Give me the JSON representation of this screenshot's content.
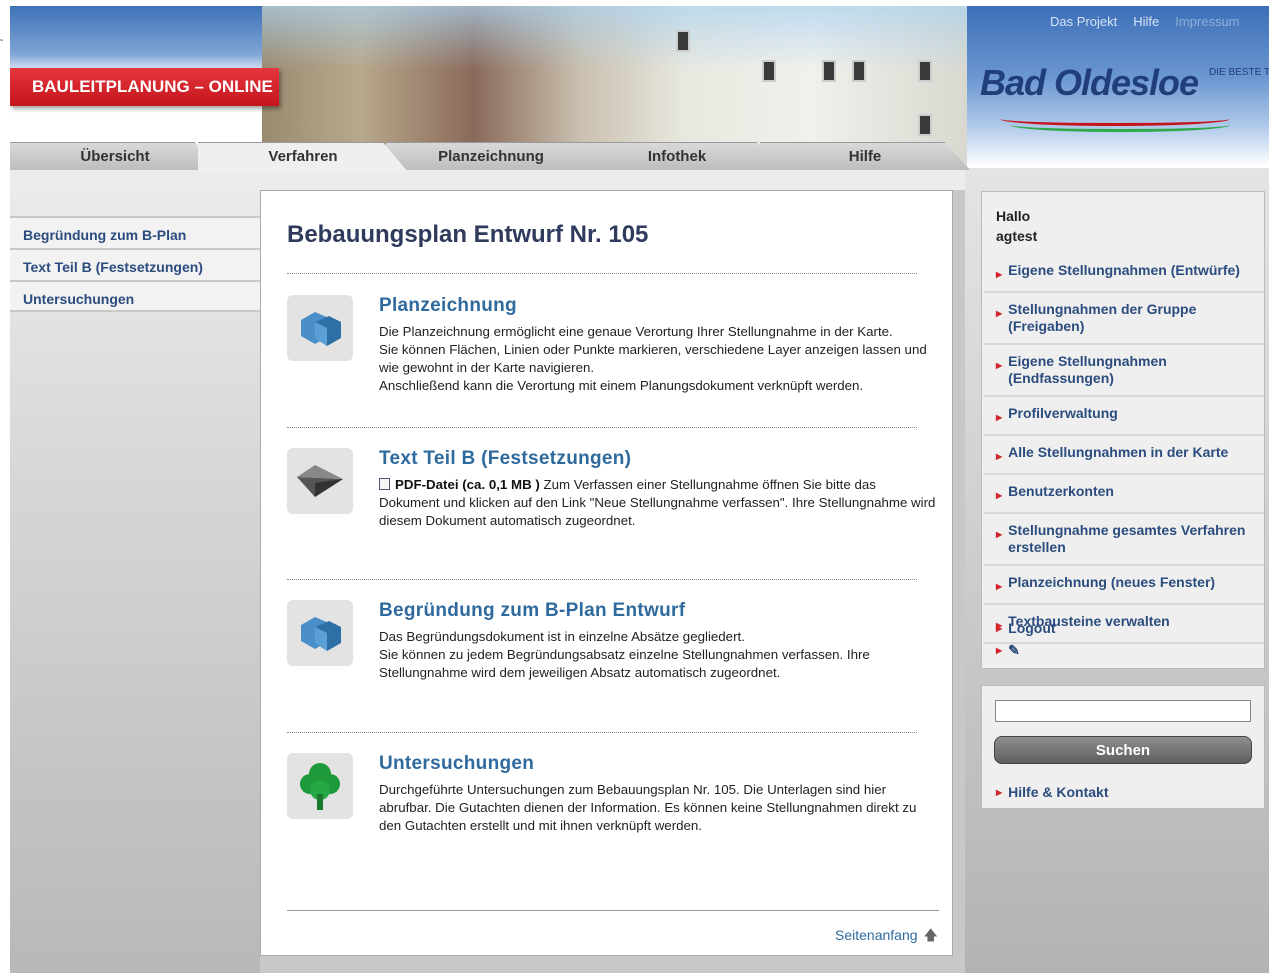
{
  "header": {
    "brand": "BAULEITPLANUNG – ONLINE",
    "top_links": [
      "Das Projekt",
      "Hilfe",
      "Impressum"
    ],
    "logo_text": "Bad Oldesloe",
    "logo_sub": "DIE BESTE TRAVE STADT"
  },
  "tabs": [
    {
      "label": "Übersicht",
      "active": false
    },
    {
      "label": "Verfahren",
      "active": true
    },
    {
      "label": "Planzeichnung",
      "active": false
    },
    {
      "label": "Infothek",
      "active": false
    },
    {
      "label": "Hilfe",
      "active": false
    }
  ],
  "left_nav": [
    "Begründung zum B-Plan",
    "Text Teil B (Festsetzungen)",
    "Untersuchungen"
  ],
  "main": {
    "title": "Bebauungsplan Entwurf Nr. 105",
    "sections": [
      {
        "icon": "cube-icon",
        "title": "Planzeichnung",
        "lines": [
          "Die Planzeichnung ermöglicht eine genaue Verortung Ihrer Stellungnahme in der Karte.",
          "Sie können Flächen, Linien oder Punkte markieren, verschiedene Layer anzeigen lassen und wie gewohnt in der Karte navigieren.",
          "Anschließend kann die Verortung mit einem Planungsdokument verknüpft werden."
        ]
      },
      {
        "icon": "paper-plane-icon",
        "title": "Text Teil B (Festsetzungen)",
        "pdf_label": "PDF-Datei (ca. 0,1 MB )",
        "text": " Zum Verfassen einer Stellungnahme öffnen Sie bitte das Dokument und klicken auf den Link \"Neue Stellungnahme verfassen\". Ihre Stellungnahme wird diesem Dokument automatisch zugeordnet."
      },
      {
        "icon": "cube-icon",
        "title": "Begründung zum B-Plan Entwurf",
        "lines": [
          "Das Begründungsdokument ist in einzelne Absätze gegliedert.",
          "Sie können zu jedem Begründungsabsatz einzelne Stellungnahmen verfassen. Ihre Stellungnahme wird dem jeweiligen Absatz automatisch zugeordnet."
        ]
      },
      {
        "icon": "tree-icon",
        "title": "Untersuchungen",
        "lines": [
          "Durchgeführte Untersuchungen zum Bebauungsplan Nr. 105. Die Unterlagen sind hier abrufbar. Die Gutachten dienen der Information. Es können keine Stellungnahmen direkt zu den Gutachten erstellt und mit ihnen verknüpft werden."
        ]
      }
    ],
    "to_top": "Seitenanfang"
  },
  "sidebar": {
    "greeting_1": "Hallo",
    "greeting_2": "agtest",
    "items": [
      "Eigene Stellungnahmen (Entwürfe)",
      "Stellungnahmen der Gruppe (Freigaben)",
      "Eigene Stellungnahmen (Endfassungen)",
      "Profilverwaltung",
      "Alle Stellungnahmen in der Karte",
      "Benutzerkonten",
      "Stellungnahme gesamtes Verfahren erstellen",
      "Planzeichnung (neues Fenster)",
      "Textbausteine verwalten"
    ],
    "logout": "Logout",
    "search_button": "Suchen",
    "search_value": "",
    "help_contact": "Hilfe & Kontakt"
  },
  "colors": {
    "brand_red": "#c4141c",
    "link_blue": "#2b4c7e",
    "title_blue": "#2f6a9e"
  }
}
